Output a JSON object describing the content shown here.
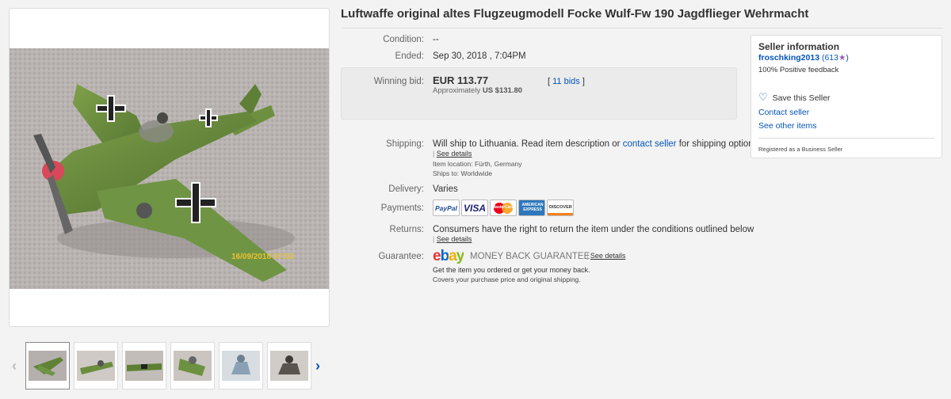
{
  "title": "Luftwaffe original altes Flugzeugmodell Focke Wulf-Fw 190 Jagdflieger Wehrmacht",
  "photo_timestamp": "16/09/2018 07:53",
  "condition": {
    "label": "Condition:",
    "value": "--"
  },
  "ended": {
    "label": "Ended:",
    "value": "Sep 30, 2018 , 7:04PM"
  },
  "bid": {
    "label": "Winning bid:",
    "price": "EUR 113.77",
    "approx_prefix": "Approximately",
    "approx_value": "US $131.80",
    "bids_open": "[",
    "bids_link": "11 bids",
    "bids_close": "]"
  },
  "shipping": {
    "label": "Shipping:",
    "text_before": "Will ship to Lithuania. Read item description or",
    "contact_link": "contact seller",
    "text_after": "for shipping options.",
    "see_details": "See details",
    "location_label": "Item location:",
    "location_value": "Fürth, Germany",
    "ships_label": "Ships to:",
    "ships_value": "Worldwide"
  },
  "delivery": {
    "label": "Delivery:",
    "value": "Varies"
  },
  "payments": {
    "label": "Payments:",
    "paypal": "PayPal",
    "visa": "VISA",
    "mastercard": "MasterCard",
    "amex": "AMERICAN EXPRESS",
    "discover": "DISCOVER"
  },
  "returns": {
    "label": "Returns:",
    "text": "Consumers have the right to return the item under the conditions outlined below",
    "see_details": "See details"
  },
  "guarantee": {
    "label": "Guarantee:",
    "logo_text": "ebay",
    "headline": "MONEY BACK GUARANTEE",
    "see_details": "See details",
    "line1": "Get the item you ordered or get your money back.",
    "line2": "Covers your purchase price and original shipping."
  },
  "seller": {
    "heading": "Seller information",
    "name": "froschking2013",
    "feedback_score": "(613",
    "feedback_close": ")",
    "positive": "100% Positive feedback",
    "save": "Save this Seller",
    "contact": "Contact seller",
    "other_items": "See other items",
    "registered": "Registered as a Business Seller"
  },
  "colors": {
    "link": "#0654ba",
    "paypal_blue": "#1b4b96",
    "star": "#9b59b6"
  },
  "icons": [
    "chevron-left-icon",
    "chevron-right-icon",
    "heart-icon",
    "star-icon"
  ]
}
